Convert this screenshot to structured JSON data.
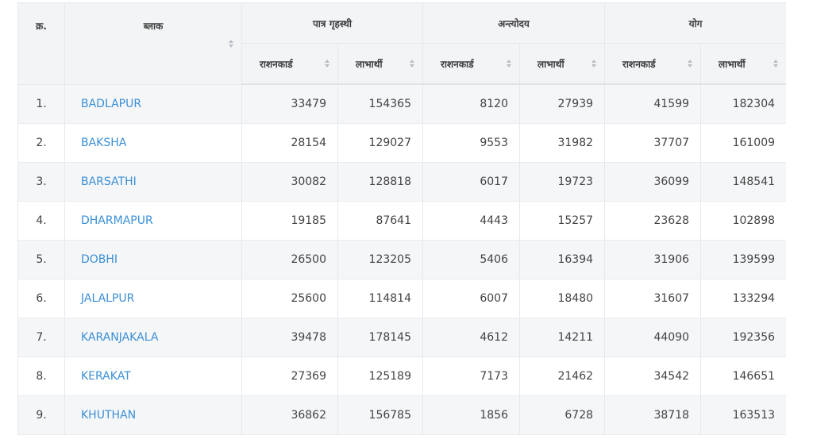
{
  "headers": {
    "serial": "क्र.",
    "block": "ब्लाक",
    "group_eligible": "पात्र गृहस्थी",
    "group_antyodaya": "अन्त्योदय",
    "group_total": "योग",
    "ration_cards": "राशनकार्ड",
    "beneficiaries": "लाभार्थी"
  },
  "rows": [
    {
      "sn": "1.",
      "block": "BADLAPUR",
      "ph_rc": "33479",
      "ph_ben": "154365",
      "ay_rc": "8120",
      "ay_ben": "27939",
      "tot_rc": "41599",
      "tot_ben": "182304"
    },
    {
      "sn": "2.",
      "block": "BAKSHA",
      "ph_rc": "28154",
      "ph_ben": "129027",
      "ay_rc": "9553",
      "ay_ben": "31982",
      "tot_rc": "37707",
      "tot_ben": "161009"
    },
    {
      "sn": "3.",
      "block": "BARSATHI",
      "ph_rc": "30082",
      "ph_ben": "128818",
      "ay_rc": "6017",
      "ay_ben": "19723",
      "tot_rc": "36099",
      "tot_ben": "148541"
    },
    {
      "sn": "4.",
      "block": "DHARMAPUR",
      "ph_rc": "19185",
      "ph_ben": "87641",
      "ay_rc": "4443",
      "ay_ben": "15257",
      "tot_rc": "23628",
      "tot_ben": "102898"
    },
    {
      "sn": "5.",
      "block": "DOBHI",
      "ph_rc": "26500",
      "ph_ben": "123205",
      "ay_rc": "5406",
      "ay_ben": "16394",
      "tot_rc": "31906",
      "tot_ben": "139599"
    },
    {
      "sn": "6.",
      "block": "JALALPUR",
      "ph_rc": "25600",
      "ph_ben": "114814",
      "ay_rc": "6007",
      "ay_ben": "18480",
      "tot_rc": "31607",
      "tot_ben": "133294"
    },
    {
      "sn": "7.",
      "block": "KARANJAKALA",
      "ph_rc": "39478",
      "ph_ben": "178145",
      "ay_rc": "4612",
      "ay_ben": "14211",
      "tot_rc": "44090",
      "tot_ben": "192356"
    },
    {
      "sn": "8.",
      "block": "KERAKAT",
      "ph_rc": "27369",
      "ph_ben": "125189",
      "ay_rc": "7173",
      "ay_ben": "21462",
      "tot_rc": "34542",
      "tot_ben": "146651"
    },
    {
      "sn": "9.",
      "block": "KHUTHAN",
      "ph_rc": "36862",
      "ph_ben": "156785",
      "ay_rc": "1856",
      "ay_ben": "6728",
      "tot_rc": "38718",
      "tot_ben": "163513"
    }
  ]
}
